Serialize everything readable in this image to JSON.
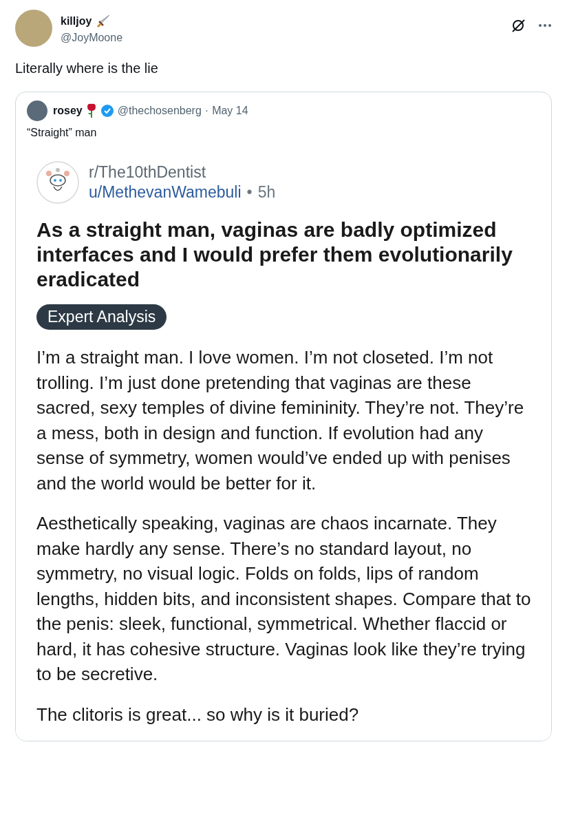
{
  "tweet": {
    "name": "killjoy",
    "handle": "@JoyMoone",
    "text": "Literally where is the lie"
  },
  "quote": {
    "name": "rosey",
    "verified": true,
    "handle": "@thechosenberg",
    "separator": "·",
    "date": "May 14",
    "text": "“Straight” man"
  },
  "reddit_post": {
    "subreddit": "r/The10thDentist",
    "user": "u/MethevanWamebuli",
    "separator": "•",
    "age": "5h",
    "title": "As a straight man, vaginas are badly optimized interfaces and I would prefer them evolutionarily eradicated",
    "flair": "Expert Analysis",
    "paragraphs": [
      "I’m a straight man. I love women. I’m not closeted. I’m not trolling. I’m just done pretending that vaginas are these sacred, sexy temples of divine femininity. They’re not. They’re a mess, both in design and function. If evolution had any sense of symmetry, women would’ve ended up with penises and the world would be better for it.",
      "Aesthetically speaking, vaginas are chaos incarnate. They make hardly any sense. There’s no standard layout, no symmetry, no visual logic. Folds on folds, lips of random lengths, hidden bits, and inconsistent shapes. Compare that to the penis: sleek, functional, symmetrical. Whether flaccid or hard, it has cohesive structure. Vaginas look like they’re trying to be secretive.",
      "The clitoris is great... so why is it buried?"
    ]
  }
}
